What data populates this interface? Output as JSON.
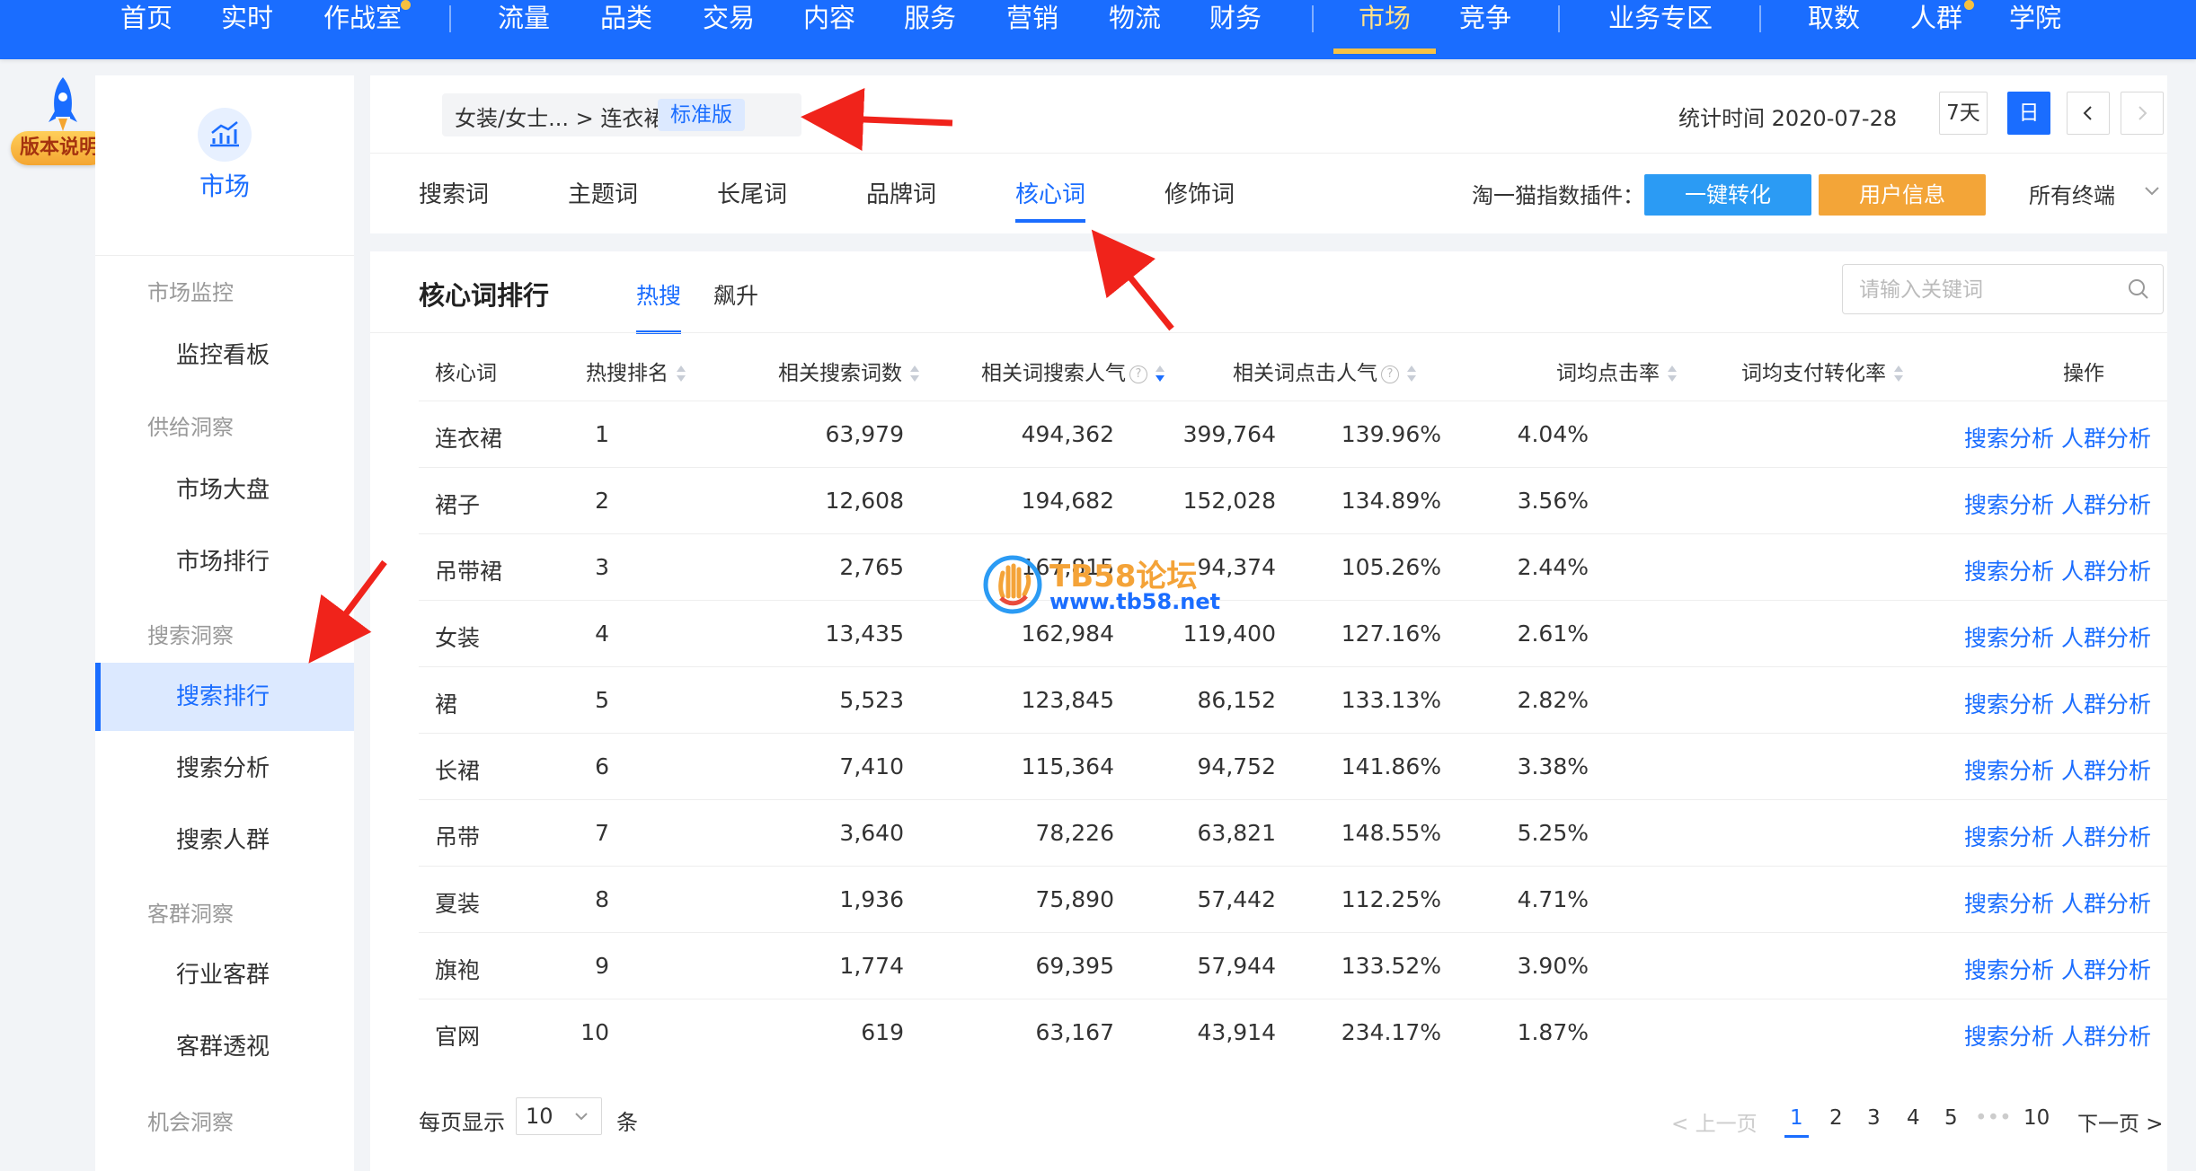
{
  "topnav": {
    "items": [
      {
        "label": "首页"
      },
      {
        "label": "实时"
      },
      {
        "label": "作战室"
      },
      {
        "label": "流量"
      },
      {
        "label": "品类"
      },
      {
        "label": "交易"
      },
      {
        "label": "内容"
      },
      {
        "label": "服务"
      },
      {
        "label": "营销"
      },
      {
        "label": "物流"
      },
      {
        "label": "财务"
      },
      {
        "label": "市场"
      },
      {
        "label": "竞争"
      },
      {
        "label": "业务专区"
      },
      {
        "label": "取数"
      },
      {
        "label": "人群"
      },
      {
        "label": "学院"
      }
    ],
    "active": "市场"
  },
  "version_badge": "版本说明",
  "sidebar": {
    "module": "市场",
    "groups": [
      {
        "label": "市场监控"
      },
      {
        "label": "供给洞察"
      },
      {
        "label": "搜索洞察"
      },
      {
        "label": "客群洞察"
      },
      {
        "label": "机会洞察"
      }
    ],
    "items": [
      {
        "label": "监控看板"
      },
      {
        "label": "市场大盘"
      },
      {
        "label": "市场排行"
      },
      {
        "label": "搜索排行"
      },
      {
        "label": "搜索分析"
      },
      {
        "label": "搜索人群"
      },
      {
        "label": "行业客群"
      },
      {
        "label": "客群透视"
      }
    ],
    "active_item": "搜索排行"
  },
  "header": {
    "breadcrumb": "女装/女士... > 连衣裙",
    "edition": "标准版",
    "stat_time": "统计时间 2020-07-28",
    "period_7d": "7天",
    "period_day": "日",
    "prev": "<",
    "next": ">",
    "tabs": [
      {
        "label": "搜索词"
      },
      {
        "label": "主题词"
      },
      {
        "label": "长尾词"
      },
      {
        "label": "品牌词"
      },
      {
        "label": "核心词"
      },
      {
        "label": "修饰词"
      }
    ],
    "active_tab": "核心词",
    "plugin_label": "淘一猫指数插件：",
    "btn_convert": "一键转化",
    "btn_userinfo": "用户信息",
    "terminal": "所有终端"
  },
  "main": {
    "title": "核心词排行",
    "subtabs": [
      {
        "label": "热搜"
      },
      {
        "label": "飙升"
      }
    ],
    "active_subtab": "热搜",
    "search_placeholder": "请输入关键词",
    "columns": [
      "核心词",
      "热搜排名",
      "相关搜索词数",
      "相关词搜索人气",
      "相关词点击人气",
      "词均点击率",
      "词均支付转化率",
      "操作"
    ],
    "rows": [
      {
        "word": "连衣裙",
        "rank": "1",
        "count": "63,979",
        "search": "494,362",
        "click": "399,764",
        "ctr": "139.96%",
        "cvr": "4.04%"
      },
      {
        "word": "裙子",
        "rank": "2",
        "count": "12,608",
        "search": "194,682",
        "click": "152,028",
        "ctr": "134.89%",
        "cvr": "3.56%"
      },
      {
        "word": "吊带裙",
        "rank": "3",
        "count": "2,765",
        "search": "167,815",
        "click": "94,374",
        "ctr": "105.26%",
        "cvr": "2.44%"
      },
      {
        "word": "女装",
        "rank": "4",
        "count": "13,435",
        "search": "162,984",
        "click": "119,400",
        "ctr": "127.16%",
        "cvr": "2.61%"
      },
      {
        "word": "裙",
        "rank": "5",
        "count": "5,523",
        "search": "123,845",
        "click": "86,152",
        "ctr": "133.13%",
        "cvr": "2.82%"
      },
      {
        "word": "长裙",
        "rank": "6",
        "count": "7,410",
        "search": "115,364",
        "click": "94,752",
        "ctr": "141.86%",
        "cvr": "3.38%"
      },
      {
        "word": "吊带",
        "rank": "7",
        "count": "3,640",
        "search": "78,226",
        "click": "63,821",
        "ctr": "148.55%",
        "cvr": "5.25%"
      },
      {
        "word": "夏装",
        "rank": "8",
        "count": "1,936",
        "search": "75,890",
        "click": "57,442",
        "ctr": "112.25%",
        "cvr": "4.71%"
      },
      {
        "word": "旗袍",
        "rank": "9",
        "count": "1,774",
        "search": "69,395",
        "click": "57,944",
        "ctr": "133.52%",
        "cvr": "3.90%"
      },
      {
        "word": "官网",
        "rank": "10",
        "count": "619",
        "search": "63,167",
        "click": "43,914",
        "ctr": "234.17%",
        "cvr": "1.87%"
      }
    ],
    "action_search": "搜索分析",
    "action_crowd": "人群分析",
    "pagesize_label": "每页显示",
    "pagesize_value": "10",
    "pagesize_unit": "条",
    "pager": {
      "prev": "< 上一页",
      "pages": [
        "1",
        "2",
        "3",
        "4",
        "5"
      ],
      "ellipsis": "•••",
      "last": "10",
      "next": "下一页 >"
    }
  },
  "watermark": {
    "line1": "TB58论坛",
    "line2": "www.tb58.net"
  },
  "colors": {
    "nav_blue": "#1a6dff",
    "active_yellow": "#f7c244",
    "btn_blue": "#2b9bf4",
    "btn_orange": "#f3a538",
    "arrow_red": "#f0231b"
  }
}
